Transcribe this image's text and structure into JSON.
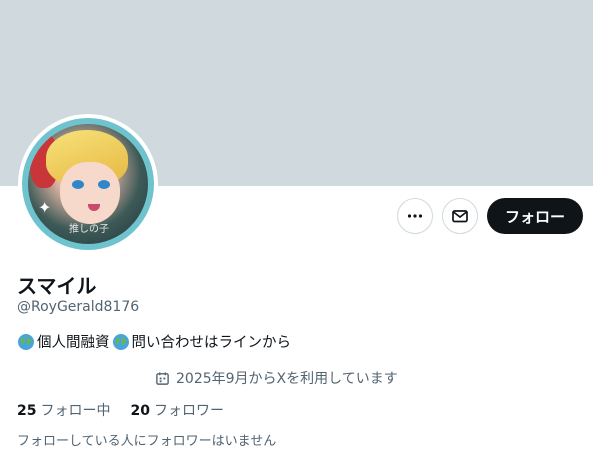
{
  "profile": {
    "display_name": "スマイル",
    "handle": "@RoyGerald8176",
    "bio_text": "個人間融資",
    "bio_text_2": "問い合わせはラインから",
    "joined": "2025年9月からXを利用しています",
    "avatar_caption": "推しの子"
  },
  "actions": {
    "follow_label": "フォロー"
  },
  "stats": {
    "following_count": "25",
    "following_label": "フォロー中",
    "followers_count": "20",
    "followers_label": "フォロワー"
  },
  "followers_note": "フォローしている人にフォロワーはいません",
  "icons": {
    "more": "more-icon",
    "message": "message-icon",
    "globe": "globe-icon",
    "calendar": "calendar-icon"
  },
  "colors": {
    "banner": "#cfd9de",
    "primary_text": "#0f1419",
    "secondary_text": "#536471",
    "follow_button": "#0f1419",
    "border": "#cfd9de",
    "avatar_ring": "#6fc3cf"
  }
}
